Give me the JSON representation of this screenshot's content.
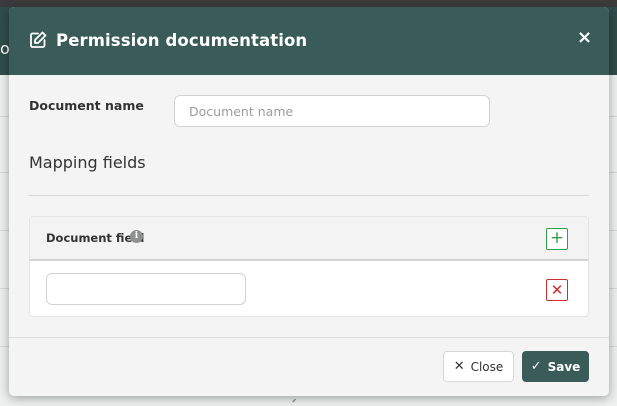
{
  "background": {
    "header_fragment": "o"
  },
  "modal": {
    "title": "Permission documentation",
    "header_icon": "edit-icon",
    "close_glyph": "×"
  },
  "form": {
    "document_name_label": "Document name",
    "document_name_placeholder": "Document name",
    "document_name_value": ""
  },
  "mapping": {
    "section_title": "Mapping fields",
    "column_header": "Document field",
    "info_glyph": "i",
    "add_glyph": "+",
    "rows": [
      {
        "value": "",
        "remove_glyph": "✕"
      }
    ]
  },
  "footer": {
    "close_label": "Close",
    "close_glyph": "✕",
    "save_label": "Save",
    "save_glyph": "✓"
  },
  "colors": {
    "header_bg": "#3a5c59",
    "add_green": "#2e9e4b",
    "remove_red": "#c9302c"
  }
}
